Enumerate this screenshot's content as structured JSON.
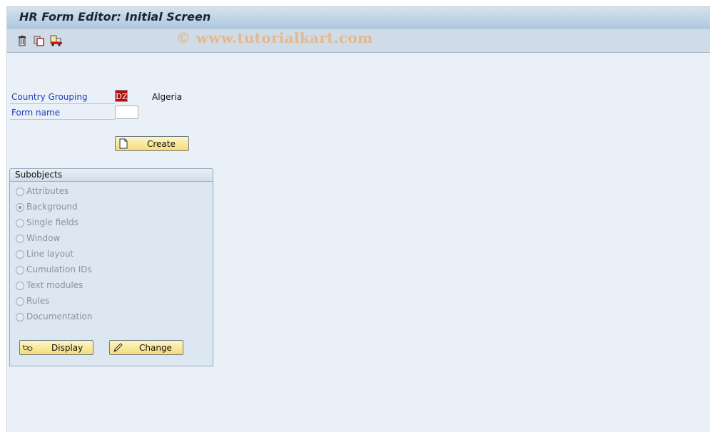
{
  "window": {
    "title": "HR Form Editor: Initial Screen"
  },
  "toolbar": {
    "icons": [
      {
        "name": "delete-icon",
        "label": "Delete"
      },
      {
        "name": "copy-icon",
        "label": "Copy"
      },
      {
        "name": "transport-icon",
        "label": "Transport"
      }
    ],
    "watermark": "© www.tutorialkart.com"
  },
  "form": {
    "country_grouping_label": "Country Grouping",
    "country_grouping_value": "DZ",
    "country_name": "Algeria",
    "form_name_label": "Form name",
    "form_name_value": "",
    "create_label": "Create"
  },
  "subobjects": {
    "title": "Subobjects",
    "options": [
      {
        "label": "Attributes",
        "selected": false
      },
      {
        "label": "Background",
        "selected": true
      },
      {
        "label": "Single fields",
        "selected": false
      },
      {
        "label": "Window",
        "selected": false
      },
      {
        "label": "Line layout",
        "selected": false
      },
      {
        "label": "Cumulation IDs",
        "selected": false
      },
      {
        "label": "Text modules",
        "selected": false
      },
      {
        "label": "Rules",
        "selected": false
      },
      {
        "label": "Documentation",
        "selected": false
      }
    ],
    "display_label": "Display",
    "change_label": "Change"
  },
  "colors": {
    "label_blue": "#1f3fb7",
    "button_yellow": "#f5dc78",
    "dz_red": "#b30d0d"
  }
}
